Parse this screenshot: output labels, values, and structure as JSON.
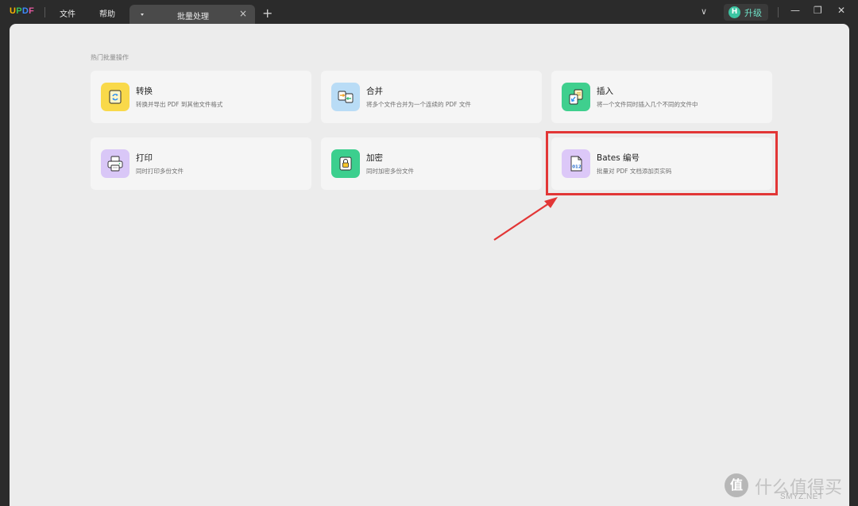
{
  "titlebar": {
    "logo": [
      "U",
      "P",
      "D",
      "F"
    ],
    "menu": {
      "file": "文件",
      "help": "帮助"
    },
    "tab": {
      "title": "批量处理",
      "close": "×"
    },
    "new_tab": "+",
    "dropdown": "∨",
    "upgrade": {
      "avatar": "H",
      "label": "升级"
    },
    "window": {
      "minimize": "—",
      "restore": "❐",
      "close": "✕"
    }
  },
  "main": {
    "section_title": "热门批量操作",
    "cards": [
      {
        "title": "转换",
        "desc": "转换并导出 PDF 到其他文件格式",
        "icon": "convert-icon",
        "color": "#f9d94a"
      },
      {
        "title": "合并",
        "desc": "将多个文件合并为一个连续的 PDF 文件",
        "icon": "combine-icon",
        "color": "#b9dcf6"
      },
      {
        "title": "插入",
        "desc": "将一个文件同时插入几个不同的文件中",
        "icon": "insert-icon",
        "color": "#3fcf8e"
      },
      {
        "title": "打印",
        "desc": "同时打印多份文件",
        "icon": "print-icon",
        "color": "#d9c7f7"
      },
      {
        "title": "加密",
        "desc": "同时加密多份文件",
        "icon": "encrypt-icon",
        "color": "#3ccf8e"
      },
      {
        "title": "Bates 编号",
        "desc": "批量对 PDF 文档添加页实码",
        "icon": "bates-number-icon",
        "color": "#dcc8f8"
      }
    ]
  },
  "watermark": {
    "badge": "值",
    "text": "什么值得买",
    "sub": "SMYZ.NET"
  },
  "colors": {
    "accent": "#e23636",
    "background": "#ececec",
    "titlebar": "#2b2b2b"
  }
}
